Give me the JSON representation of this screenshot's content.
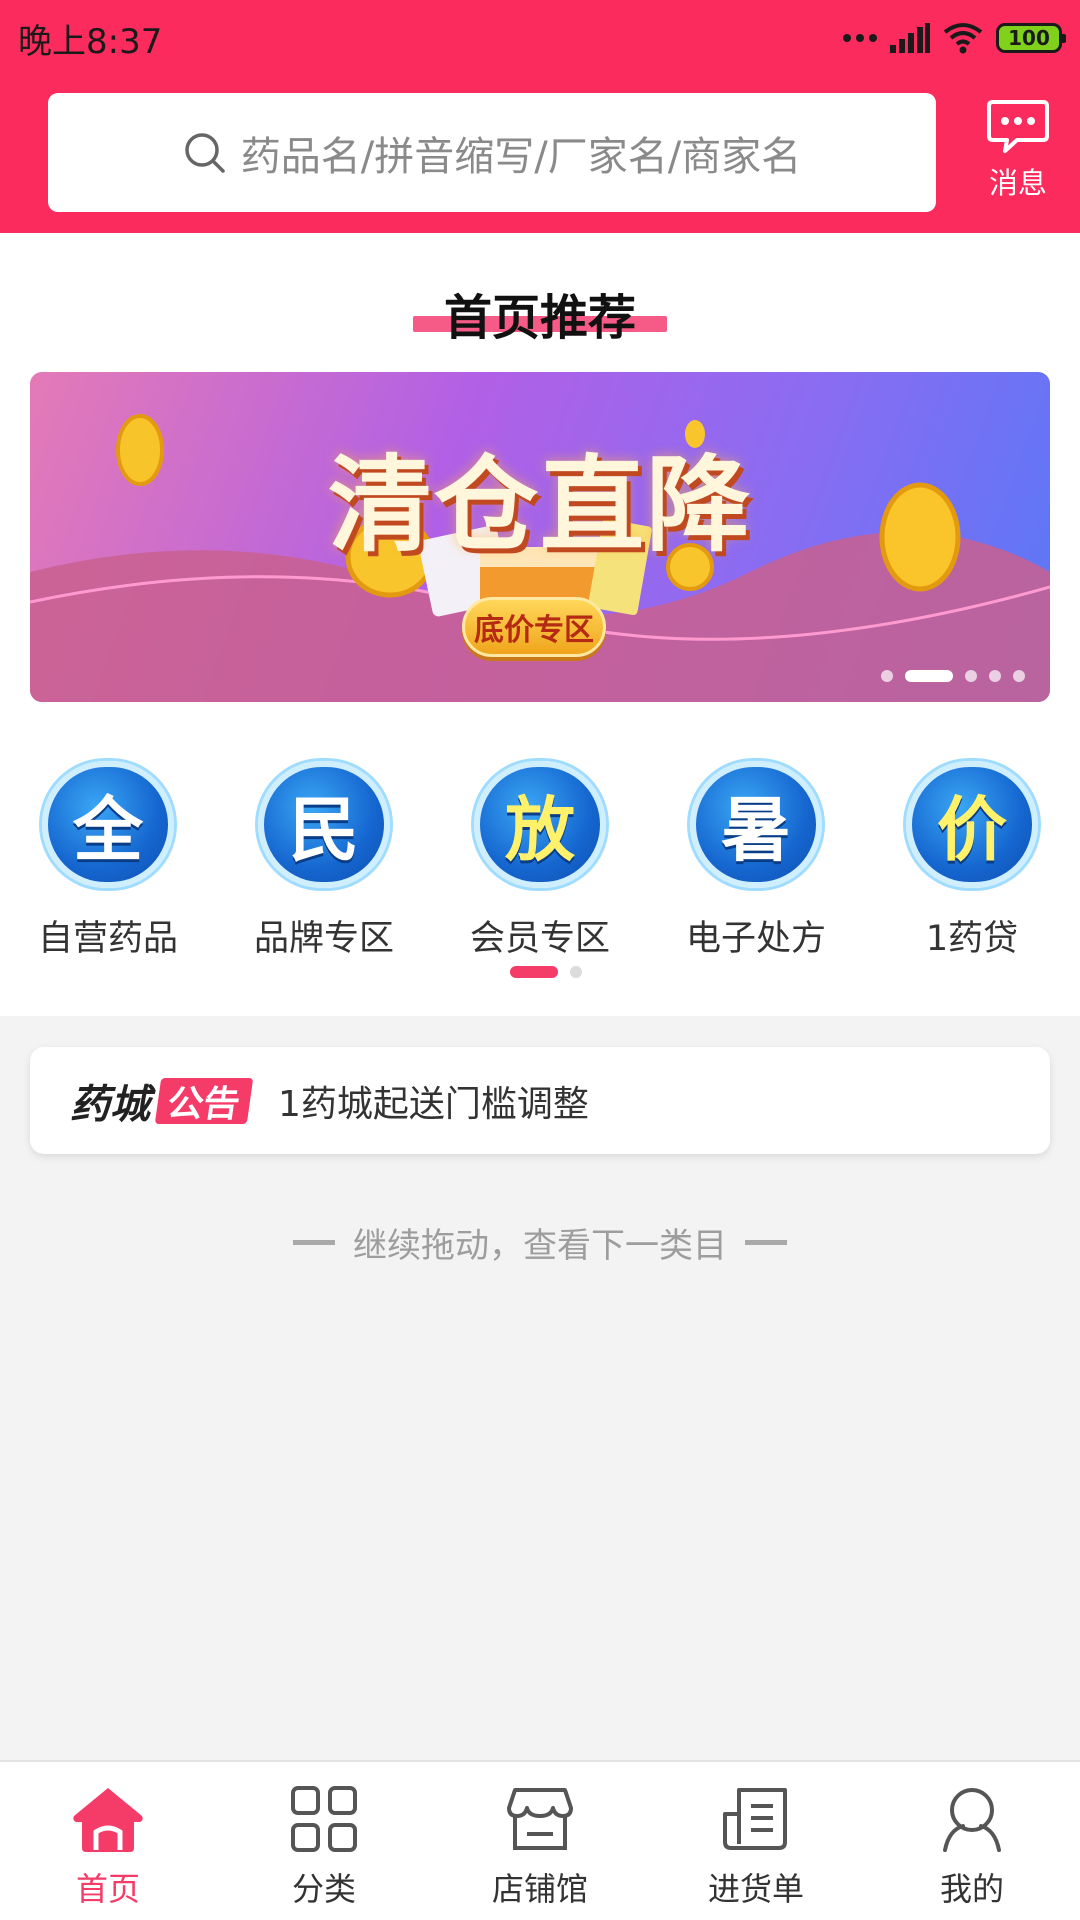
{
  "status_bar": {
    "time": "晚上8:37",
    "battery": "100"
  },
  "search": {
    "placeholder": "药品名/拼音缩写/厂家名/商家名"
  },
  "message": {
    "label": "消息"
  },
  "recommend": {
    "title": "首页推荐",
    "banner": {
      "headline": "清仓直降",
      "button": "底价专区",
      "slide_count": 5,
      "active_slide": 2
    }
  },
  "categories": [
    {
      "glyph": "全",
      "label": "自营药品"
    },
    {
      "glyph": "民",
      "label": "品牌专区"
    },
    {
      "glyph": "放",
      "label": "会员专区"
    },
    {
      "glyph": "暑",
      "label": "电子处方"
    },
    {
      "glyph": "价",
      "label": "1药贷"
    }
  ],
  "notice": {
    "brand": "药城",
    "tag": "公告",
    "text": "1药城起送门槛调整"
  },
  "hint": "继续拖动，查看下一类目",
  "tabs": [
    {
      "label": "首页",
      "icon": "home-icon",
      "active": true
    },
    {
      "label": "分类",
      "icon": "grid-icon",
      "active": false
    },
    {
      "label": "店铺馆",
      "icon": "store-icon",
      "active": false
    },
    {
      "label": "进货单",
      "icon": "order-list-icon",
      "active": false
    },
    {
      "label": "我的",
      "icon": "person-icon",
      "active": false
    }
  ],
  "colors": {
    "brand": "#fc2b5d",
    "accent": "#f53b68",
    "category_blue": "#1566cf"
  }
}
